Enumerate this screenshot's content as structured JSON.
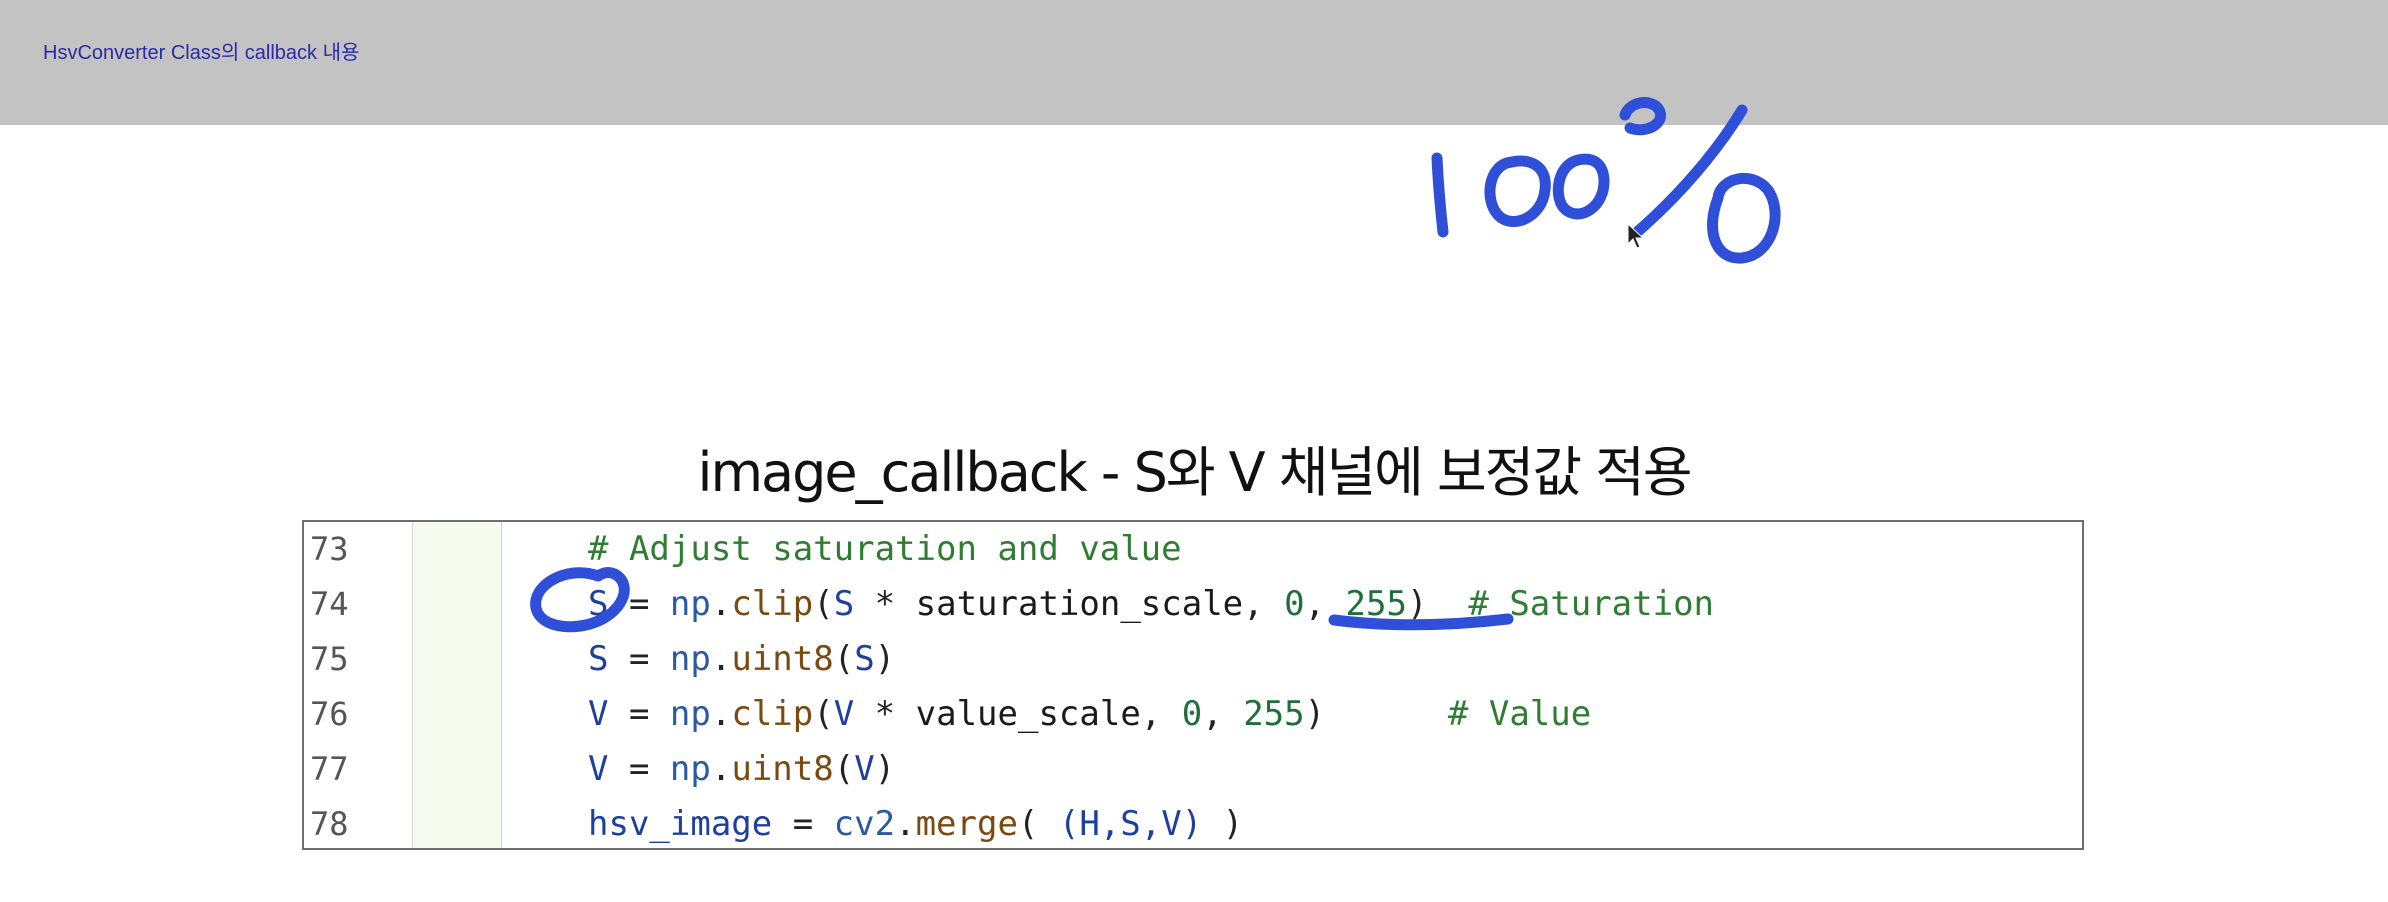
{
  "header": {
    "title": "HsvConverter Class의 callback 내용"
  },
  "slide": {
    "title": "image_callback - S와 V 채널에 보정값 적용"
  },
  "annotations": {
    "handwritten_text": "100%",
    "ink_color": "#2f4fd8"
  },
  "code": {
    "lines": [
      {
        "number": "73",
        "tokens": [
          {
            "text": "# Adjust saturation and value",
            "type": "comment"
          }
        ]
      },
      {
        "number": "74",
        "tokens": [
          {
            "text": "S",
            "type": "var"
          },
          {
            "text": " = ",
            "type": "op"
          },
          {
            "text": "np",
            "type": "mod"
          },
          {
            "text": ".",
            "type": "op"
          },
          {
            "text": "clip",
            "type": "fn"
          },
          {
            "text": "(",
            "type": "op"
          },
          {
            "text": "S",
            "type": "var"
          },
          {
            "text": " * ",
            "type": "op"
          },
          {
            "text": "saturation_scale",
            "type": "plain"
          },
          {
            "text": ", ",
            "type": "op"
          },
          {
            "text": "0",
            "type": "num"
          },
          {
            "text": ", ",
            "type": "op"
          },
          {
            "text": "255",
            "type": "num"
          },
          {
            "text": ")  ",
            "type": "op"
          },
          {
            "text": "# Saturation",
            "type": "comment"
          }
        ]
      },
      {
        "number": "75",
        "tokens": [
          {
            "text": "S",
            "type": "var"
          },
          {
            "text": " = ",
            "type": "op"
          },
          {
            "text": "np",
            "type": "mod"
          },
          {
            "text": ".",
            "type": "op"
          },
          {
            "text": "uint8",
            "type": "fn"
          },
          {
            "text": "(",
            "type": "op"
          },
          {
            "text": "S",
            "type": "var"
          },
          {
            "text": ")",
            "type": "op"
          }
        ]
      },
      {
        "number": "76",
        "tokens": [
          {
            "text": "V",
            "type": "var"
          },
          {
            "text": " = ",
            "type": "op"
          },
          {
            "text": "np",
            "type": "mod"
          },
          {
            "text": ".",
            "type": "op"
          },
          {
            "text": "clip",
            "type": "fn"
          },
          {
            "text": "(",
            "type": "op"
          },
          {
            "text": "V",
            "type": "var"
          },
          {
            "text": " * ",
            "type": "op"
          },
          {
            "text": "value_scale",
            "type": "plain"
          },
          {
            "text": ", ",
            "type": "op"
          },
          {
            "text": "0",
            "type": "num"
          },
          {
            "text": ", ",
            "type": "op"
          },
          {
            "text": "255",
            "type": "num"
          },
          {
            "text": ")      ",
            "type": "op"
          },
          {
            "text": "# Value",
            "type": "comment"
          }
        ]
      },
      {
        "number": "77",
        "tokens": [
          {
            "text": "V",
            "type": "var"
          },
          {
            "text": " = ",
            "type": "op"
          },
          {
            "text": "np",
            "type": "mod"
          },
          {
            "text": ".",
            "type": "op"
          },
          {
            "text": "uint8",
            "type": "fn"
          },
          {
            "text": "(",
            "type": "op"
          },
          {
            "text": "V",
            "type": "var"
          },
          {
            "text": ")",
            "type": "op"
          }
        ]
      },
      {
        "number": "78",
        "tokens": [
          {
            "text": "hsv_image",
            "type": "var"
          },
          {
            "text": " = ",
            "type": "op"
          },
          {
            "text": "cv2",
            "type": "mod"
          },
          {
            "text": ".",
            "type": "op"
          },
          {
            "text": "merge",
            "type": "fn"
          },
          {
            "text": "( ",
            "type": "op"
          },
          {
            "text": "(H,S,V)",
            "type": "var"
          },
          {
            "text": " )",
            "type": "op"
          }
        ]
      }
    ]
  }
}
